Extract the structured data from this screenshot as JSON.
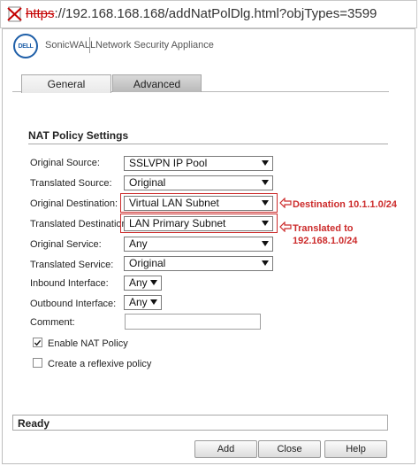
{
  "browser": {
    "url_protocol": "https",
    "url_rest": "://192.168.168.168/addNatPolDlg.html?objTypes=3599"
  },
  "header": {
    "logo_text": "DELL",
    "brand": "SonicWALL",
    "product": "Network Security Appliance"
  },
  "tabs": [
    {
      "label": "General",
      "active": true
    },
    {
      "label": "Advanced",
      "active": false
    }
  ],
  "section": {
    "title": "NAT Policy Settings"
  },
  "fields": {
    "original_source": {
      "label": "Original Source:",
      "value": "SSLVPN IP Pool"
    },
    "translated_source": {
      "label": "Translated Source:",
      "value": "Original"
    },
    "original_destination": {
      "label": "Original Destination:",
      "value": "Virtual LAN Subnet"
    },
    "translated_destination": {
      "label": "Translated Destination:",
      "value": "LAN Primary Subnet"
    },
    "original_service": {
      "label": "Original Service:",
      "value": "Any"
    },
    "translated_service": {
      "label": "Translated Service:",
      "value": "Original"
    },
    "inbound_interface": {
      "label": "Inbound Interface:",
      "value": "Any"
    },
    "outbound_interface": {
      "label": "Outbound Interface:",
      "value": "Any"
    },
    "comment": {
      "label": "Comment:",
      "value": ""
    }
  },
  "checkboxes": {
    "enable_nat": {
      "label": "Enable NAT Policy",
      "checked": true
    },
    "reflexive": {
      "label": "Create a reflexive policy",
      "checked": false
    }
  },
  "annotations": {
    "destination": "Destination 10.1.1.0/24",
    "translated_line1": "Translated to",
    "translated_line2": "192.168.1.0/24",
    "color": "#cc2b2b"
  },
  "status": {
    "text": "Ready"
  },
  "buttons": {
    "add": "Add",
    "close": "Close",
    "help": "Help"
  }
}
